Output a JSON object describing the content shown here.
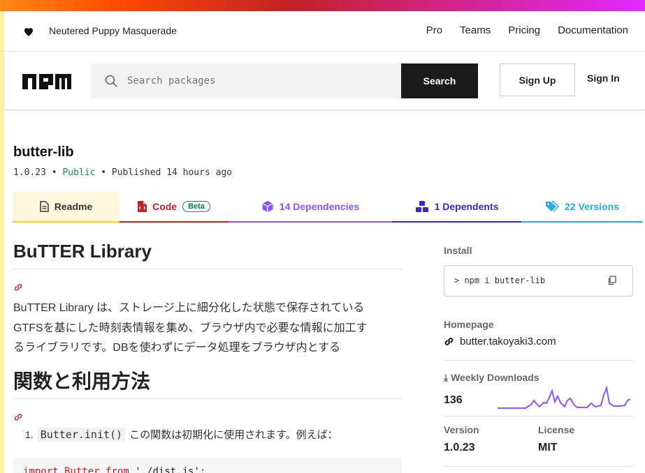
{
  "topnav": {
    "tagline": "Neutered Puppy Masquerade",
    "links": [
      "Pro",
      "Teams",
      "Pricing",
      "Documentation"
    ]
  },
  "header": {
    "search_placeholder": "Search packages",
    "search_button": "Search",
    "sign_up": "Sign Up",
    "sign_in": "Sign In"
  },
  "package": {
    "name": "butter-lib",
    "version": "1.0.23",
    "visibility": "Public",
    "published": "Published 14 hours ago"
  },
  "tabs": {
    "readme": "Readme",
    "code": "Code",
    "code_badge": "Beta",
    "dependencies": "14 Dependencies",
    "dependents": "1 Dependents",
    "versions": "22 Versions"
  },
  "readme": {
    "title": "BuTTER Library",
    "intro_lines": [
      "BuTTER Library は、ストレージ上に細分化した状態で保存されている",
      "GTFSを基にした時刻表情報を集め、ブラウザ内で必要な情報に加工す",
      "るライブラリです。DBを使わずにデータ処理をブラウザ内とする"
    ],
    "section_title": "関数と利用方法",
    "list_number": "1.",
    "list_code": "Butter.init()",
    "list_text": "この関数は初期化に使用されます。例えば：",
    "code_kw1": "import",
    "code_name": "Butter",
    "code_kw2": "from",
    "code_path": "'./dist.js';"
  },
  "sidebar": {
    "install_label": "Install",
    "install_cmd": "> npm i butter-lib",
    "homepage_label": "Homepage",
    "homepage_url": "butter.takoyaki3.com",
    "downloads_label": "Weekly Downloads",
    "downloads_count": "136",
    "version_label": "Version",
    "version_value": "1.0.23",
    "license_label": "License",
    "license_value": "MIT"
  },
  "colors": {
    "code_tab": "#c12127",
    "deps_tab": "#8956ff",
    "dependents_tab": "#3a26c9",
    "versions_tab": "#29abe2",
    "readme_tab_bg": "#fff8df",
    "sparkline": "#8956ff"
  }
}
